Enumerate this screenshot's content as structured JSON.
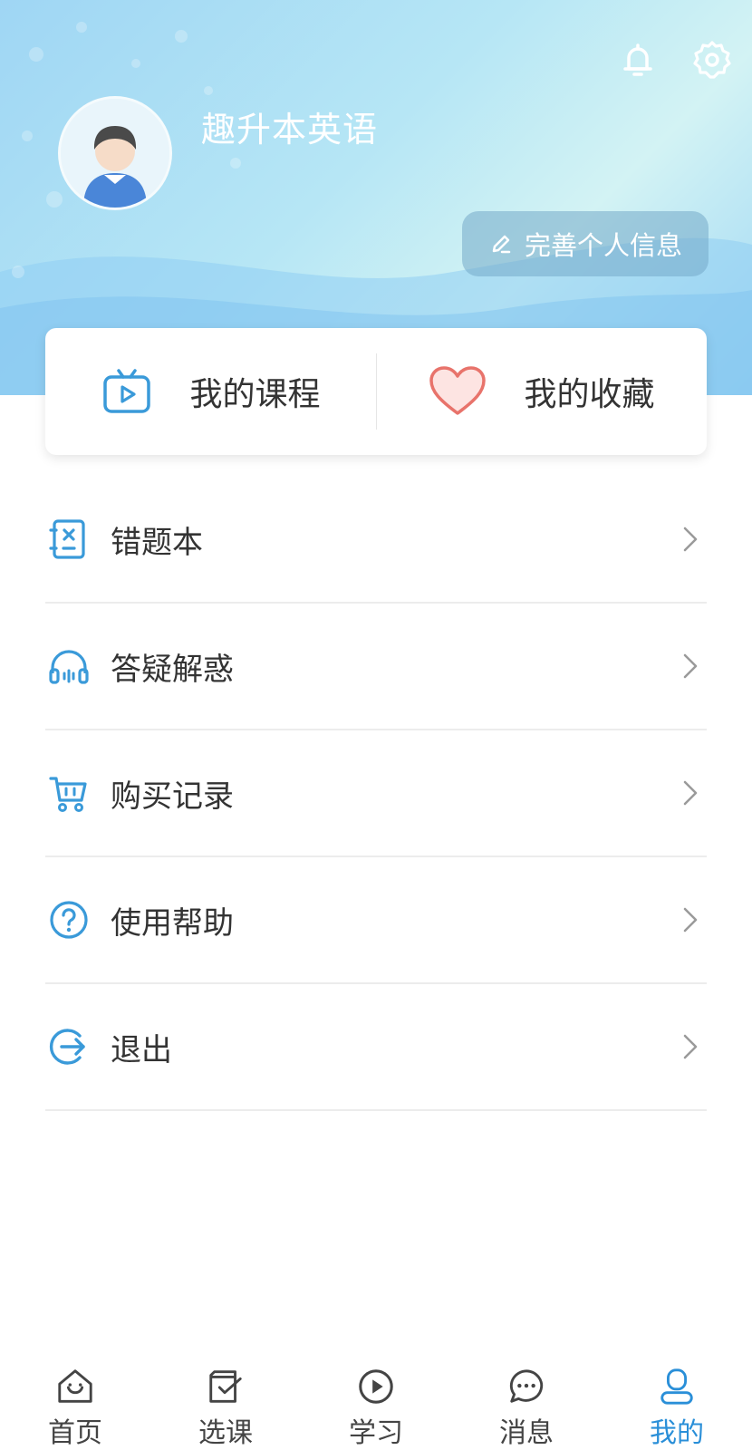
{
  "profile": {
    "username": "趣升本英语",
    "edit_label": "完善个人信息"
  },
  "quick_actions": [
    {
      "label": "我的课程",
      "icon": "tv-play-icon"
    },
    {
      "label": "我的收藏",
      "icon": "heart-icon"
    }
  ],
  "menu": [
    {
      "label": "错题本",
      "icon": "wrong-notebook-icon"
    },
    {
      "label": "答疑解惑",
      "icon": "headphones-icon"
    },
    {
      "label": "购买记录",
      "icon": "cart-icon"
    },
    {
      "label": "使用帮助",
      "icon": "question-circle-icon"
    },
    {
      "label": "退出",
      "icon": "logout-icon"
    }
  ],
  "tabs": [
    {
      "label": "首页",
      "icon": "home-icon",
      "active": false
    },
    {
      "label": "选课",
      "icon": "course-select-icon",
      "active": false
    },
    {
      "label": "学习",
      "icon": "play-circle-icon",
      "active": false
    },
    {
      "label": "消息",
      "icon": "chat-icon",
      "active": false
    },
    {
      "label": "我的",
      "icon": "user-icon",
      "active": true
    }
  ],
  "colors": {
    "accent": "#2a8fd8",
    "icon_blue": "#3a9ad9",
    "heart": "#e8736b",
    "text": "#333333"
  }
}
